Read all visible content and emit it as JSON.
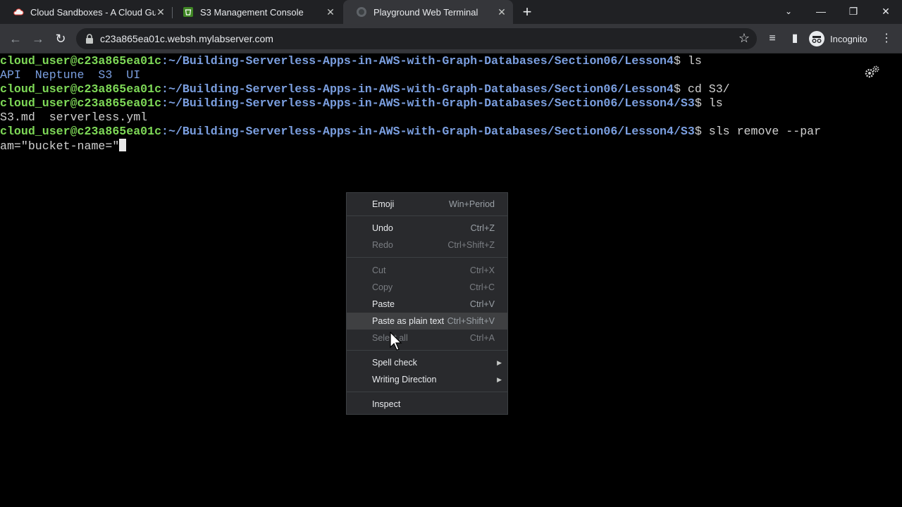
{
  "tabs": [
    {
      "title": "Cloud Sandboxes - A Cloud Guru",
      "icon": "cloud-icon",
      "active": false
    },
    {
      "title": "S3 Management Console",
      "icon": "s3-bucket-icon",
      "active": false
    },
    {
      "title": "Playground Web Terminal",
      "icon": "terminal-globe-icon",
      "active": true
    }
  ],
  "toolbar": {
    "url": "c23a865ea01c.websh.mylabserver.com",
    "profile_label": "Incognito"
  },
  "terminal": {
    "prompt_user": "cloud_user@c23a865ea01c",
    "lines": [
      {
        "path": ":~/Building-Serverless-Apps-in-AWS-with-Graph-Databases/Section06/Lesson4",
        "cmd": "$ ls"
      },
      {
        "path": ":~/Building-Serverless-Apps-in-AWS-with-Graph-Databases/Section06/Lesson4",
        "cmd": "$ cd S3/"
      },
      {
        "path": ":~/Building-Serverless-Apps-in-AWS-with-Graph-Databases/Section06/Lesson4/S3",
        "cmd": "$ ls"
      },
      {
        "path": ":~/Building-Serverless-Apps-in-AWS-with-Graph-Databases/Section06/Lesson4/S3",
        "cmd": "$ sls remove --par"
      }
    ],
    "ls1_output": "API  Neptune  S3  UI",
    "ls2_output": "S3.md  serverless.yml",
    "wrap_line": "am=\"bucket-name=\""
  },
  "context_menu": {
    "items": [
      {
        "label": "Emoji",
        "shortcut": "Win+Period",
        "disabled": false
      },
      {
        "label": "Undo",
        "shortcut": "Ctrl+Z",
        "disabled": false
      },
      {
        "label": "Redo",
        "shortcut": "Ctrl+Shift+Z",
        "disabled": true
      },
      {
        "label": "Cut",
        "shortcut": "Ctrl+X",
        "disabled": true
      },
      {
        "label": "Copy",
        "shortcut": "Ctrl+C",
        "disabled": true
      },
      {
        "label": "Paste",
        "shortcut": "Ctrl+V",
        "disabled": false
      },
      {
        "label": "Paste as plain text",
        "shortcut": "Ctrl+Shift+V",
        "disabled": false,
        "highlighted": true
      },
      {
        "label": "Select all",
        "shortcut": "Ctrl+A",
        "disabled": true
      },
      {
        "label": "Spell check",
        "shortcut": "",
        "submenu": true
      },
      {
        "label": "Writing Direction",
        "shortcut": "",
        "submenu": true
      },
      {
        "label": "Inspect",
        "shortcut": ""
      }
    ]
  },
  "colors": {
    "prompt_user": "#7ed957",
    "prompt_path": "#7b9fe0",
    "menu_bg": "#292a2d",
    "tab_bg": "#202124"
  }
}
